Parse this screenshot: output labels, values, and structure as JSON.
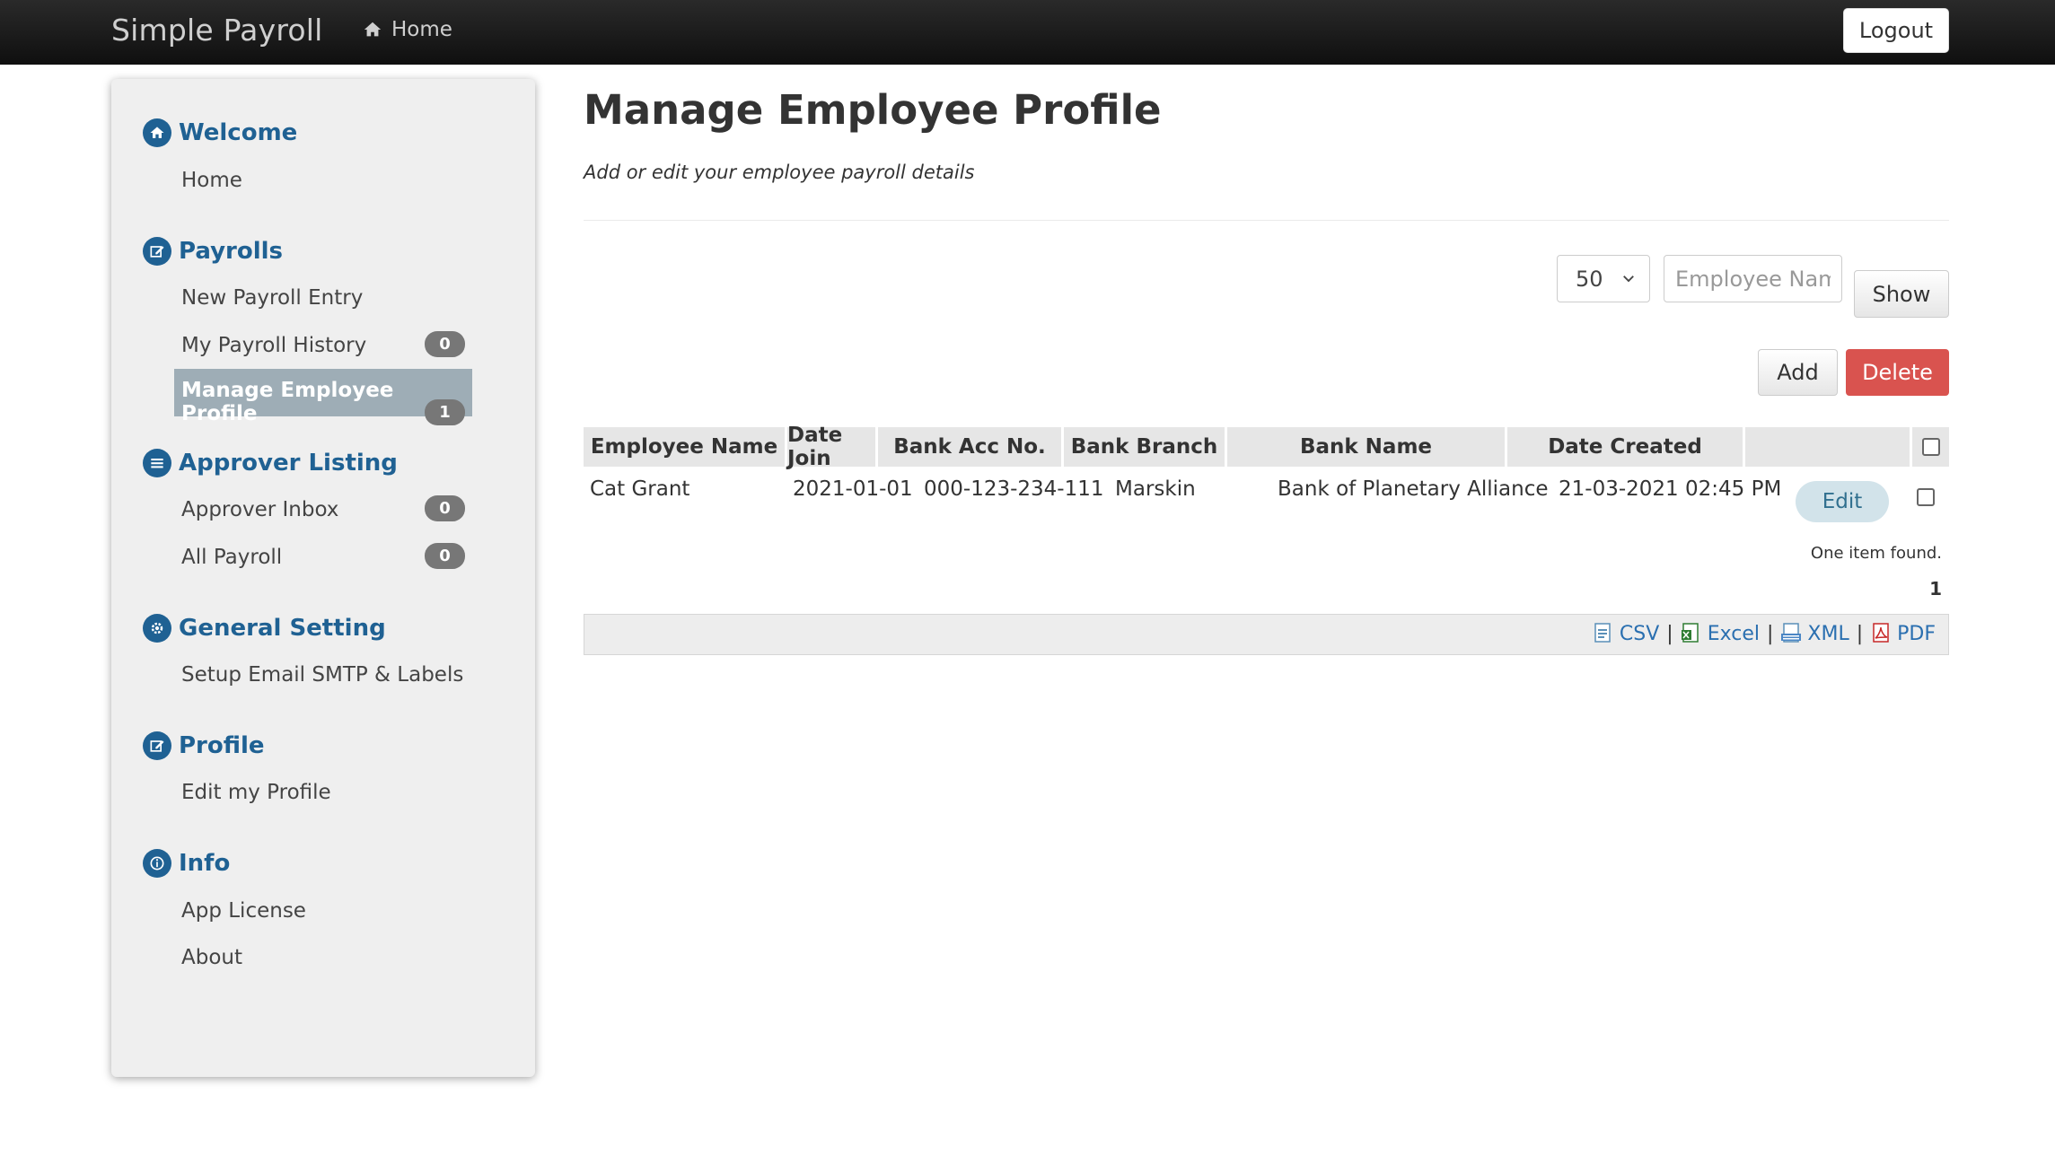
{
  "navbar": {
    "brand": "Simple Payroll",
    "home_label": "Home",
    "logout_label": "Logout"
  },
  "sidebar": {
    "sections": [
      {
        "title": "Welcome",
        "icon": "home-icon",
        "items": [
          {
            "label": "Home"
          }
        ]
      },
      {
        "title": "Payrolls",
        "icon": "edit-icon",
        "items": [
          {
            "label": "New Payroll Entry"
          },
          {
            "label": "My Payroll History",
            "badge": "0"
          },
          {
            "label": "Manage Employee Profile",
            "badge": "1",
            "active": true
          }
        ]
      },
      {
        "title": "Approver Listing",
        "icon": "list-icon",
        "items": [
          {
            "label": "Approver Inbox",
            "badge": "0"
          },
          {
            "label": "All Payroll",
            "badge": "0"
          }
        ]
      },
      {
        "title": "General Setting",
        "icon": "gear-icon",
        "items": [
          {
            "label": "Setup Email SMTP & Labels"
          }
        ]
      },
      {
        "title": "Profile",
        "icon": "edit-icon",
        "items": [
          {
            "label": "Edit my Profile"
          }
        ]
      },
      {
        "title": "Info",
        "icon": "info-icon",
        "items": [
          {
            "label": "App License"
          },
          {
            "label": "About"
          }
        ]
      }
    ]
  },
  "main": {
    "title": "Manage Employee Profile",
    "subtitle": "Add or edit your employee payroll details",
    "per_page": "50",
    "search_placeholder": "Employee Name",
    "show_label": "Show",
    "add_label": "Add",
    "delete_label": "Delete",
    "columns": [
      "Employee Name",
      "Date Join",
      "Bank Acc No.",
      "Bank Branch",
      "Bank Name",
      "Date Created"
    ],
    "rows": [
      {
        "employee_name": "Cat Grant",
        "date_join": "2021-01-01",
        "bank_acc": "000-123-234-111",
        "bank_branch": "Marskin",
        "bank_name": "Bank of Planetary Alliance",
        "date_created": "21-03-2021 02:45 PM",
        "action": "Edit"
      }
    ],
    "summary": "One item found.",
    "page": "1",
    "exports": [
      "CSV",
      "Excel",
      "XML",
      "PDF"
    ],
    "separator": "|"
  },
  "colors": {
    "navbar": "#1a1a1a",
    "accent": "#1f6193",
    "active_item": "#9eadb6",
    "danger": "#d9534f",
    "link": "#2a6fb0"
  }
}
